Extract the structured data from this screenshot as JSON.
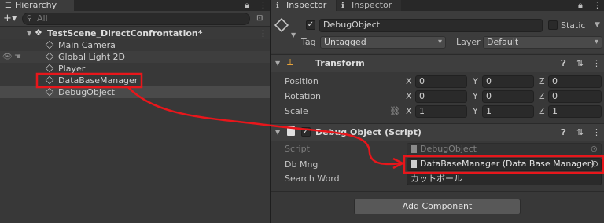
{
  "hierarchy": {
    "tab_label": "Hierarchy",
    "lock_icon": "lock-icon",
    "menu_icon": "⋮",
    "add_label": "+▾",
    "search_placeholder": "All",
    "scene_name": "TestScene_DirectConfrontation*",
    "items": [
      "Main Camera",
      "Global Light 2D",
      "Player",
      "DataBaseManager",
      "DebugObject"
    ]
  },
  "inspector": {
    "tab1_label": "Inspector",
    "tab2_label": "Inspector",
    "object_name": "DebugObject",
    "static_label": "Static",
    "tag_label": "Tag",
    "tag_value": "Untagged",
    "layer_label": "Layer",
    "layer_value": "Default",
    "transform": {
      "title": "Transform",
      "position_label": "Position",
      "rotation_label": "Rotation",
      "scale_label": "Scale",
      "position": [
        "0",
        "0",
        "0"
      ],
      "rotation": [
        "0",
        "0",
        "0"
      ],
      "scale": [
        "1",
        "1",
        "1"
      ],
      "axis_x": "X",
      "axis_y": "Y",
      "axis_z": "Z"
    },
    "debug_script": {
      "title": "Debug Object (Script)",
      "script_label": "Script",
      "script_value": "DebugObject",
      "dbmng_label": "Db Mng",
      "dbmng_value": "DataBaseManager (Data Base Manager)",
      "search_label": "Search Word",
      "search_value": "カットボール"
    },
    "add_component_label": "Add Component"
  },
  "annotation_color": "#e8161b"
}
